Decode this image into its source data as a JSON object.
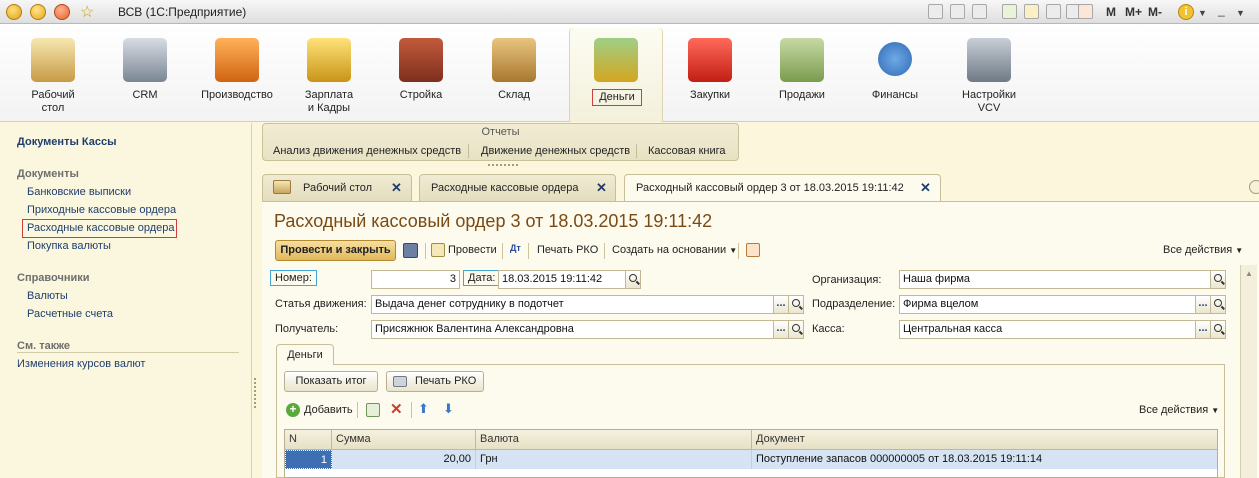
{
  "window": {
    "title": "ВСВ  (1С:Предприятие)"
  },
  "titlebar_right": {
    "m": "M",
    "m_plus": "M+",
    "m_minus": "M-"
  },
  "sections": [
    {
      "label": "Рабочий\nстол",
      "icon": "desk-icon"
    },
    {
      "label": "CRM",
      "icon": "handshake-icon"
    },
    {
      "label": "Производство",
      "icon": "factory-icon"
    },
    {
      "label": "Зарплата\nи Кадры",
      "icon": "coins-icon"
    },
    {
      "label": "Стройка",
      "icon": "bricks-icon"
    },
    {
      "label": "Склад",
      "icon": "box-icon"
    },
    {
      "label": "Деньги",
      "icon": "money-icon"
    },
    {
      "label": "Закупки",
      "icon": "cart-icon"
    },
    {
      "label": "Продажи",
      "icon": "money-bag-icon"
    },
    {
      "label": "Финансы",
      "icon": "dollar-icon"
    },
    {
      "label": "Настройки\nVCV",
      "icon": "tools-icon"
    }
  ],
  "left_panel": {
    "header": "Документы Кассы",
    "group_docs": "Документы",
    "docs": [
      "Банковские выписки",
      "Приходные кассовые ордера",
      "Расходные кассовые ордера",
      "Покупка валюты"
    ],
    "group_refs": "Справочники",
    "refs": [
      "Валюты",
      "Расчетные счета"
    ],
    "group_see_also": "См. также",
    "see_also": [
      "Изменения курсов валют"
    ]
  },
  "reports": {
    "title": "Отчеты",
    "items": [
      "Анализ движения денежных средств",
      "Движение денежных средств",
      "Кассовая книга"
    ]
  },
  "tabs": [
    {
      "label": "Рабочий стол"
    },
    {
      "label": "Расходные кассовые ордера"
    },
    {
      "label": "Расходный кассовый ордер 3 от 18.03.2015 19:11:42"
    }
  ],
  "form": {
    "title": "Расходный кассовый ордер 3 от 18.03.2015 19:11:42",
    "toolbar": {
      "post_close": "Провести и закрыть",
      "post": "Провести",
      "print_rko": "Печать РКО",
      "create_based": "Создать на основании",
      "all_actions": "Все действия"
    },
    "fields": {
      "number_label": "Номер:",
      "number_value": "3",
      "date_label": "Дата:",
      "date_value": "18.03.2015 19:11:42",
      "article_label": "Статья движения:",
      "article_value": "Выдача денег сотруднику в подотчет",
      "recipient_label": "Получатель:",
      "recipient_value": "Присяжнюк Валентина Александровна",
      "org_label": "Организация:",
      "org_value": "Наша фирма",
      "dept_label": "Подразделение:",
      "dept_value": "Фирма вцелом",
      "cash_label": "Касса:",
      "cash_value": "Центральная касса"
    },
    "inner_tab": "Деньги",
    "inner_toolbar": {
      "show_total": "Показать итог",
      "print_rko": "Печать РКО",
      "add": "Добавить",
      "all_actions": "Все действия"
    },
    "table": {
      "headers": [
        "N",
        "Сумма",
        "Валюта",
        "Документ"
      ],
      "rows": [
        {
          "n": "1",
          "sum": "20,00",
          "currency": "Грн",
          "document": "Поступление запасов 000000005 от 18.03.2015 19:11:14"
        }
      ]
    }
  },
  "colors": {
    "highlight": "#d43c3c",
    "title": "#7a4a14",
    "link": "#1f3e6e",
    "selected_row": "#d6e3f3"
  }
}
